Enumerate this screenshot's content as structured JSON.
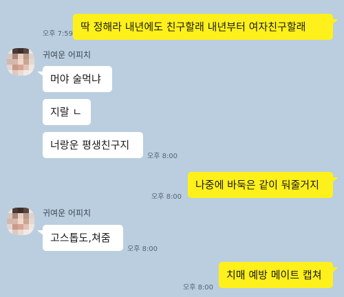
{
  "colors": {
    "background": "#bacee0",
    "my_bubble": "#fef01b",
    "other_bubble": "#ffffff"
  },
  "messages": [
    {
      "from": "me",
      "text": "딱 정해라 내년에도 친구할래 내년부터 여자친구할래",
      "time": "오후 7:59"
    },
    {
      "from": "other",
      "sender": "귀여운 어피치",
      "text": "머야 술먹냐"
    },
    {
      "from": "other",
      "text": "지랄 ㄴ"
    },
    {
      "from": "other",
      "text": "너랑운 평생친구지",
      "time": "오후 8:00"
    },
    {
      "from": "me",
      "text": "나중에 바둑은 같이 둬줄거지",
      "time": "오후 8:00"
    },
    {
      "from": "other",
      "sender": "귀여운 어피치",
      "text": "고스톱도,쳐줌",
      "time": "오후 8:00"
    },
    {
      "from": "me",
      "text": "치매 예방 메이트 캡쳐",
      "time": "오후 8:00"
    }
  ]
}
